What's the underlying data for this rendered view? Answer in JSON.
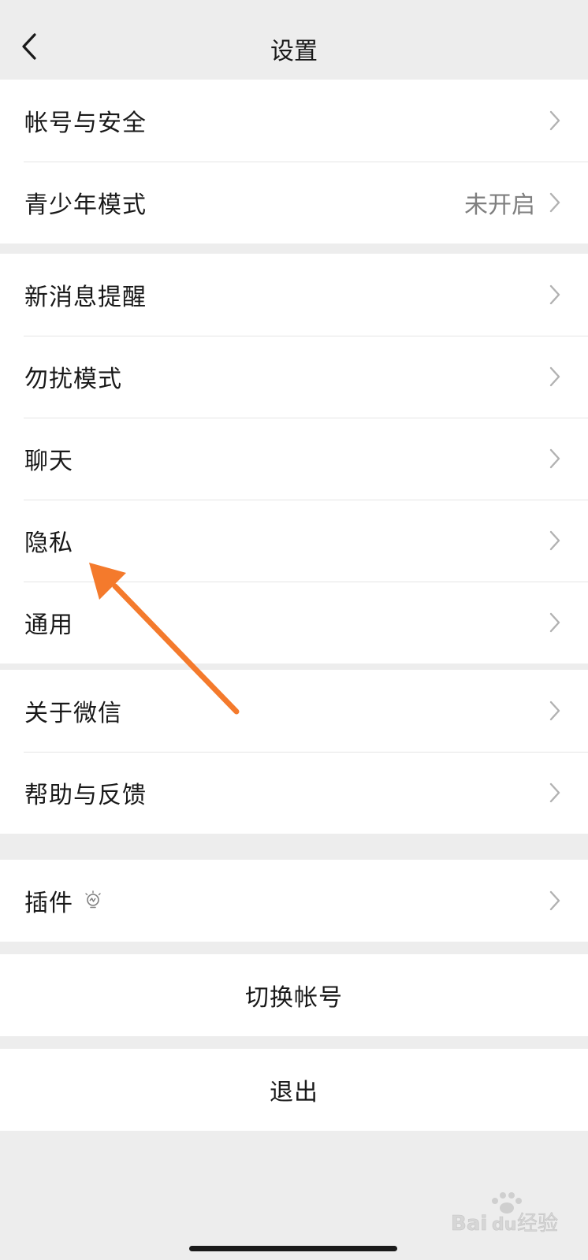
{
  "nav": {
    "title": "设置"
  },
  "groups": [
    {
      "items": [
        {
          "label": "帐号与安全",
          "value": ""
        },
        {
          "label": "青少年模式",
          "value": "未开启"
        }
      ]
    },
    {
      "items": [
        {
          "label": "新消息提醒"
        },
        {
          "label": "勿扰模式"
        },
        {
          "label": "聊天"
        },
        {
          "label": "隐私"
        },
        {
          "label": "通用"
        }
      ]
    },
    {
      "items": [
        {
          "label": "关于微信"
        },
        {
          "label": "帮助与反馈"
        }
      ]
    },
    {
      "items": [
        {
          "label": "插件",
          "icon": "lightbulb-icon"
        }
      ]
    }
  ],
  "switch_account": {
    "label": "切换帐号"
  },
  "logout": {
    "label": "退出"
  },
  "annotation": {
    "color": "#f47a2c",
    "target": "隐私"
  },
  "watermark": {
    "text": "Baidu经验"
  }
}
